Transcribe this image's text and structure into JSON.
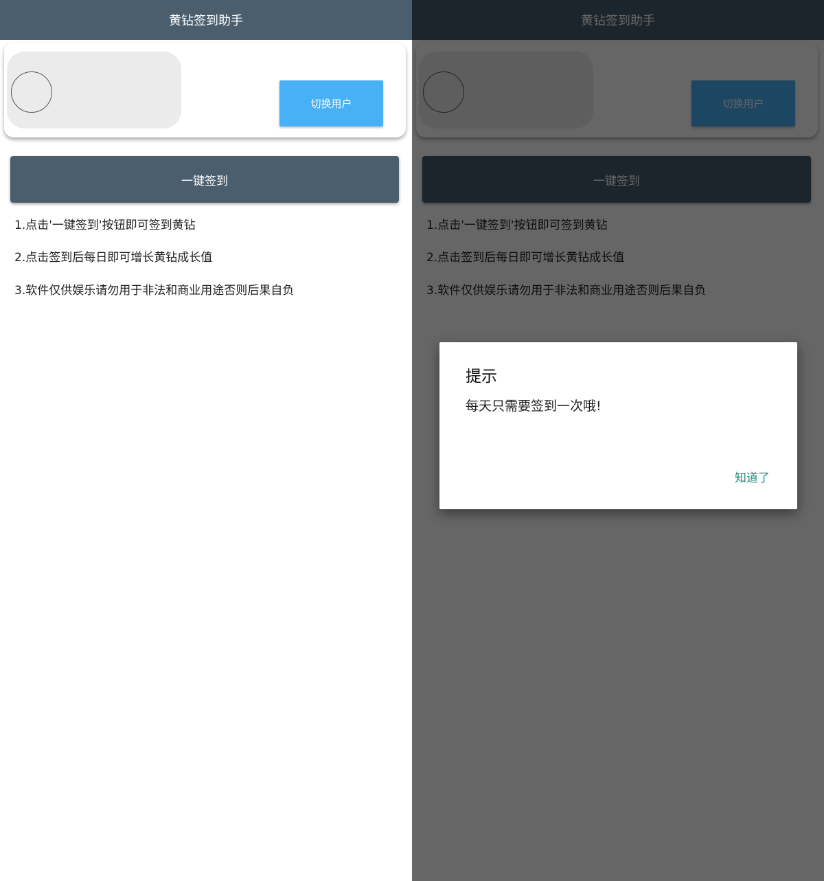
{
  "app": {
    "title": "黄钻签到助手"
  },
  "user_card": {
    "switch_user_label": "切换用户"
  },
  "main": {
    "signin_label": "一键签到",
    "tips": [
      "1.点击'一键签到'按钮即可签到黄钻",
      "2.点击签到后每日即可增长黄钻成长值",
      "3.软件仅供娱乐请勿用于非法和商业用途否则后果自负"
    ]
  },
  "dialog": {
    "title": "提示",
    "message": "每天只需要签到一次哦!",
    "ok_label": "知道了"
  },
  "colors": {
    "appbar": "#4a5e6e",
    "switch_button": "#48b0f5",
    "dialog_action": "#1f8a7a",
    "scrim": "rgba(0,0,0,0.6)"
  }
}
